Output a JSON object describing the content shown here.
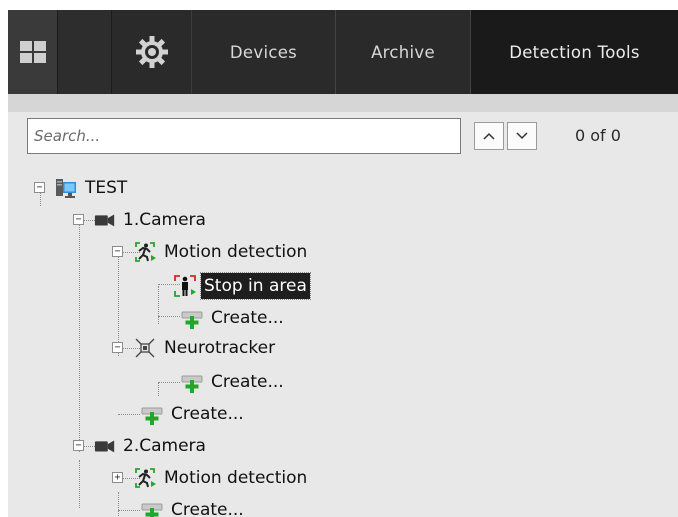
{
  "toolbar": {
    "tabs": [
      {
        "id": "devices",
        "label": "Devices"
      },
      {
        "id": "archive",
        "label": "Archive"
      },
      {
        "id": "detection",
        "label": "Detection Tools"
      }
    ],
    "grid_icon": "grid-layout-icon",
    "settings_icon": "gear-icon"
  },
  "search": {
    "placeholder": "Search...",
    "value": "",
    "up_icon": "chevron-up-icon",
    "down_icon": "chevron-down-icon",
    "counter": "0 of 0"
  },
  "tree": {
    "root": {
      "label": "TEST",
      "icon": "server-icon"
    },
    "cameras": [
      {
        "label": "1.Camera",
        "icon": "camera-icon",
        "tools": [
          {
            "label": "Motion detection",
            "icon": "motion-detection-icon"
          },
          {
            "label": "Stop in area",
            "icon": "stop-in-area-icon",
            "selected": true
          },
          {
            "label": "Create...",
            "icon": "create-plus-icon"
          },
          {
            "label": "Neurotracker",
            "icon": "neurotracker-icon"
          },
          {
            "label": "Create...",
            "icon": "create-plus-icon"
          },
          {
            "label": "Create...",
            "icon": "create-plus-icon"
          }
        ]
      },
      {
        "label": "2.Camera",
        "icon": "camera-icon",
        "tools": [
          {
            "label": "Motion detection",
            "icon": "motion-detection-icon"
          },
          {
            "label": "Create...",
            "icon": "create-plus-icon"
          }
        ]
      }
    ]
  },
  "colors": {
    "toolbar_bg": "#2a2a2a",
    "active_tab_bg": "#1a1a1a",
    "panel_bg": "#e8e8e8",
    "selection_bg": "#1e1e1e",
    "accent_green": "#1fa82b",
    "accent_red": "#d42a1c"
  }
}
